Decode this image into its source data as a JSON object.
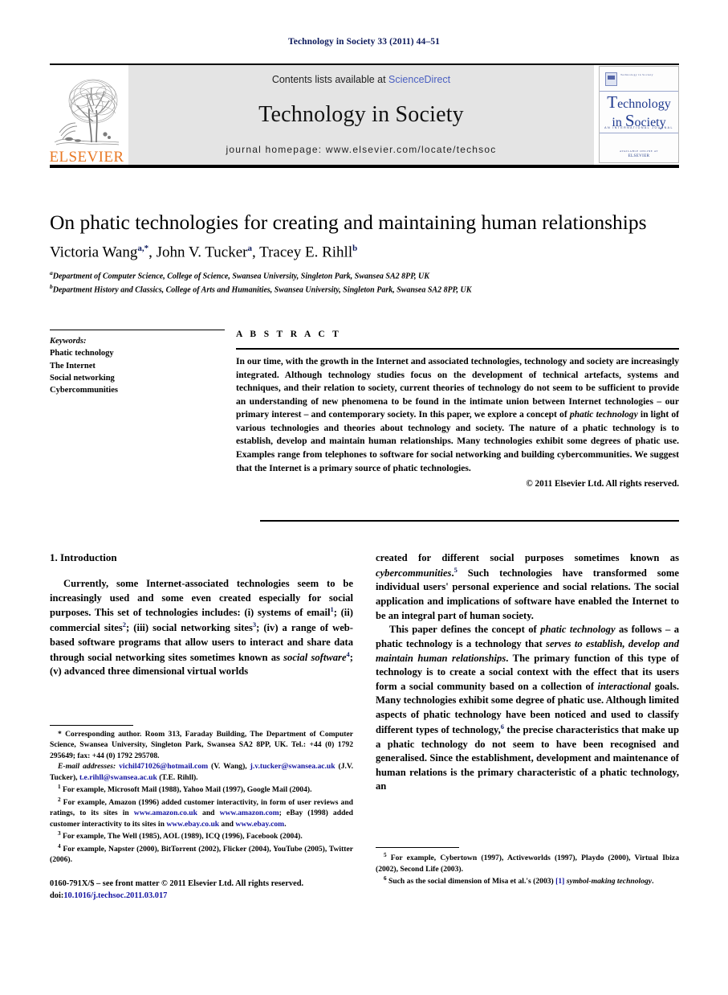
{
  "running_head": "Technology in Society 33 (2011) 44–51",
  "masthead": {
    "publisher_wordmark": "ELSEVIER",
    "contents_prefix": "Contents lists available at ",
    "contents_link": "ScienceDirect",
    "journal_name": "Technology in Society",
    "homepage_line": "journal homepage: www.elsevier.com/locate/techsoc",
    "cover": {
      "tiny_header": "Technology in Society",
      "title_line1_cap": "T",
      "title_line1_rest": "echnology",
      "title_line2_pre": "in ",
      "title_line2_cap": "S",
      "title_line2_rest": "ociety",
      "subtitle": "AN INTERNATIONAL JOURNAL",
      "footer_text": "AVAILABLE ONLINE AT",
      "footer_logo": "ELSEVIER"
    }
  },
  "article": {
    "title": "On phatic technologies for creating and maintaining human relationships",
    "authors": [
      {
        "name": "Victoria Wang",
        "marks": "a,*"
      },
      {
        "name": "John V. Tucker",
        "marks": "a"
      },
      {
        "name": "Tracey E. Rihll",
        "marks": "b"
      }
    ],
    "affiliations": [
      {
        "mark": "a",
        "text": "Department of Computer Science, College of Science, Swansea University, Singleton Park, Swansea SA2 8PP, UK"
      },
      {
        "mark": "b",
        "text": "Department History and Classics, College of Arts and Humanities, Swansea University, Singleton Park, Swansea SA2 8PP, UK"
      }
    ]
  },
  "keywords": {
    "heading": "Keywords:",
    "items": [
      "Phatic technology",
      "The Internet",
      "Social networking",
      "Cybercommunities"
    ]
  },
  "abstract": {
    "label": "A B S T R A C T",
    "part1": "In our time, with the growth in the Internet and associated technologies, technology and society are increasingly integrated. Although technology studies focus on the development of technical artefacts, systems and techniques, and their relation to society, current theories of technology do not seem to be sufficient to provide an understanding of new phenomena to be found in the intimate union between Internet technologies – our primary interest – and contemporary society. In this paper, we explore a concept of ",
    "italic1": "phatic technology",
    "part2": " in light of various technologies and theories about technology and society. The nature of a phatic technology is to establish, develop and maintain human relationships. Many technologies exhibit some degrees of phatic use. Examples range from telephones to software for social networking and building cybercommunities. We suggest that the Internet is a primary source of phatic technologies.",
    "copyright": "© 2011 Elsevier Ltd. All rights reserved."
  },
  "sections": {
    "intro_heading": "1. Introduction"
  },
  "columns": {
    "left_p1_a": "Currently, some Internet-associated technologies seem to be increasingly used and some even created especially for social purposes. This set of technologies includes: (i) systems of email",
    "left_p1_sup1": "1",
    "left_p1_b": "; (ii) commercial sites",
    "left_p1_sup2": "2",
    "left_p1_c": "; (iii) social networking sites",
    "left_p1_sup3": "3",
    "left_p1_d": "; (iv) a range of web-based software programs that allow users to interact and share data through social networking sites sometimes known as ",
    "left_p1_italic": "social software",
    "left_p1_sup4": "4",
    "left_p1_e": "; (v) advanced three dimensional virtual worlds",
    "right_p1_a": "created for different social purposes sometimes known as ",
    "right_p1_italic": "cybercommunities",
    "right_p1_sup5": "5",
    "right_p1_b": " Such technologies have transformed some individual users' personal experience and social relations. The social application and implications of software have enabled the Internet to be an integral part of human society.",
    "right_p2_a": "This paper defines the concept of ",
    "right_p2_italic1": "phatic technology",
    "right_p2_b": " as follows – a phatic technology is a technology that ",
    "right_p2_italic2": "serves to establish, develop and maintain human relationships",
    "right_p2_c": ". The primary function of this type of technology is to create a social context with the effect that its users form a social community based on a collection of ",
    "right_p2_italic3": "interactional",
    "right_p2_d": " goals. Many technologies exhibit some degree of phatic use. Although limited aspects of phatic technology have been noticed and used to classify different types of technology,",
    "right_p2_sup6": "6",
    "right_p2_e": " the precise characteristics that make up a phatic technology do not seem to have been recognised and generalised. Since the establishment, development and maintenance of human relations is the primary characteristic of a phatic technology, an"
  },
  "footnotes": {
    "corresponding_mark": "*",
    "corresponding": " Corresponding author. Room 313, Faraday Building, The Department of Computer Science, Swansea University, Singleton Park, Swansea SA2 8PP, UK. Tel.: +44 (0) 1792 295649; fax: +44 (0) 1792 295708.",
    "email_label": "E-mail addresses:",
    "email1": "vichil471026@hotmail.com",
    "email1_who": " (V. Wang), ",
    "email2": "j.v.tucker@swansea.ac.uk",
    "email2_who": " (J.V. Tucker), ",
    "email3": "t.e.rihll@swansea.ac.uk",
    "email3_who": " (T.E. Rihll).",
    "fn1_mark": "1",
    "fn1": " For example, Microsoft Mail (1988), Yahoo Mail (1997), Google Mail (2004).",
    "fn2_mark": "2",
    "fn2_a": " For example, Amazon (1996) added customer interactivity, in form of user reviews and ratings, to its sites in ",
    "fn2_link1": "www.amazon.co.uk",
    "fn2_b": " and ",
    "fn2_link2": "www.amazon.com",
    "fn2_c": "; eBay (1998) added customer interactivity to its sites in ",
    "fn2_link3": "www.ebay.co.uk",
    "fn2_d": " and ",
    "fn2_link4": "www.ebay.com",
    "fn2_e": ".",
    "fn3_mark": "3",
    "fn3": " For example, The Well (1985), AOL (1989), ICQ (1996), Facebook (2004).",
    "fn4_mark": "4",
    "fn4": " For example, Napster (2000), BitTorrent (2002), Flicker (2004), YouTube (2005), Twitter (2006).",
    "fn5_mark": "5",
    "fn5": " For example, Cybertown (1997), Activeworlds (1997), Playdo (2000), Virtual Ibiza (2002), Second Life (2003).",
    "fn6_mark": "6",
    "fn6_a": " Such as the social dimension of Misa et al.'s (2003) ",
    "fn6_ref": "[1]",
    "fn6_italic": " symbol-making technology",
    "fn6_b": "."
  },
  "imprint": {
    "issn_line": "0160-791X/$ – see front matter © 2011 Elsevier Ltd. All rights reserved.",
    "doi_label": "doi:",
    "doi_value": "10.1016/j.techsoc.2011.03.017"
  },
  "colors": {
    "running_head": "#0d1a5c",
    "sciencedirect": "#4a5fc1",
    "elsevier_orange": "#E87722",
    "link_blue": "#1414a0",
    "banner_gray": "#e4e4e4"
  }
}
